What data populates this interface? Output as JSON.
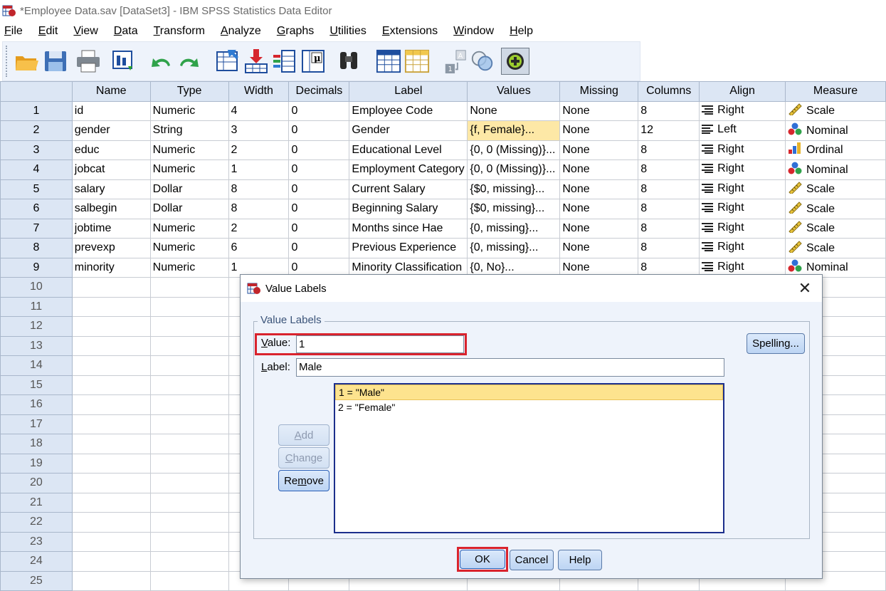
{
  "window": {
    "title": "*Employee Data.sav [DataSet3] - IBM SPSS Statistics Data Editor"
  },
  "menu": [
    "File",
    "Edit",
    "View",
    "Data",
    "Transform",
    "Analyze",
    "Graphs",
    "Utilities",
    "Extensions",
    "Window",
    "Help"
  ],
  "toolbar": {
    "icons": [
      "open-icon",
      "save-icon",
      "print-icon",
      "dialog-recall-icon",
      "undo-icon",
      "redo-icon",
      "goto-case-icon",
      "goto-variable-icon",
      "variables-icon",
      "value-labels-icon",
      "find-icon",
      "insert-cases-icon",
      "insert-variable-icon",
      "split-file-icon",
      "use-sets-icon",
      "spelling-icon",
      "customize-icon"
    ]
  },
  "grid": {
    "headers": [
      "Name",
      "Type",
      "Width",
      "Decimals",
      "Label",
      "Values",
      "Missing",
      "Columns",
      "Align",
      "Measure"
    ],
    "rows": [
      {
        "n": "1",
        "name": "id",
        "type": "Numeric",
        "width": "4",
        "decimals": "0",
        "label": "Employee Code",
        "values": "None",
        "missing": "None",
        "columns": "8",
        "align": "Right",
        "measure": "Scale"
      },
      {
        "n": "2",
        "name": "gender",
        "type": "String",
        "width": "3",
        "decimals": "0",
        "label": "Gender",
        "values": "{f, Female}...",
        "missing": "None",
        "columns": "12",
        "align": "Left",
        "measure": "Nominal"
      },
      {
        "n": "3",
        "name": "educ",
        "type": "Numeric",
        "width": "2",
        "decimals": "0",
        "label": "Educational Level",
        "values": "{0, 0 (Missing)}...",
        "missing": "None",
        "columns": "8",
        "align": "Right",
        "measure": "Ordinal"
      },
      {
        "n": "4",
        "name": "jobcat",
        "type": "Numeric",
        "width": "1",
        "decimals": "0",
        "label": "Employment Category",
        "values": "{0, 0 (Missing)}...",
        "missing": "None",
        "columns": "8",
        "align": "Right",
        "measure": "Nominal"
      },
      {
        "n": "5",
        "name": "salary",
        "type": "Dollar",
        "width": "8",
        "decimals": "0",
        "label": "Current Salary",
        "values": "{$0, missing}...",
        "missing": "None",
        "columns": "8",
        "align": "Right",
        "measure": "Scale"
      },
      {
        "n": "6",
        "name": "salbegin",
        "type": "Dollar",
        "width": "8",
        "decimals": "0",
        "label": "Beginning Salary",
        "values": "{$0, missing}...",
        "missing": "None",
        "columns": "8",
        "align": "Right",
        "measure": "Scale"
      },
      {
        "n": "7",
        "name": "jobtime",
        "type": "Numeric",
        "width": "2",
        "decimals": "0",
        "label": "Months since Hae",
        "values": "{0, missing}...",
        "missing": "None",
        "columns": "8",
        "align": "Right",
        "measure": "Scale"
      },
      {
        "n": "8",
        "name": "prevexp",
        "type": "Numeric",
        "width": "6",
        "decimals": "0",
        "label": "Previous Experience",
        "values": "{0, missing}...",
        "missing": "None",
        "columns": "8",
        "align": "Right",
        "measure": "Scale"
      },
      {
        "n": "9",
        "name": "minority",
        "type": "Numeric",
        "width": "1",
        "decimals": "0",
        "label": "Minority Classification",
        "values": "{0, No}...",
        "missing": "None",
        "columns": "8",
        "align": "Right",
        "measure": "Nominal"
      }
    ],
    "empty_rows": [
      "10",
      "11",
      "12",
      "13",
      "14",
      "15",
      "16",
      "17",
      "18",
      "19",
      "20",
      "21",
      "22",
      "23",
      "24",
      "25"
    ]
  },
  "dialog": {
    "title": "Value Labels",
    "group_title": "Value Labels",
    "value_label": "Value:",
    "value": "1",
    "label_label": "Label:",
    "label": "Male",
    "list": [
      "1 = \"Male\"",
      "2 = \"Female\""
    ],
    "buttons": {
      "spelling": "Spelling...",
      "add": "Add",
      "change": "Change",
      "remove": "Remove",
      "ok": "OK",
      "cancel": "Cancel",
      "help": "Help"
    },
    "highlight_color": "#d9232d"
  }
}
